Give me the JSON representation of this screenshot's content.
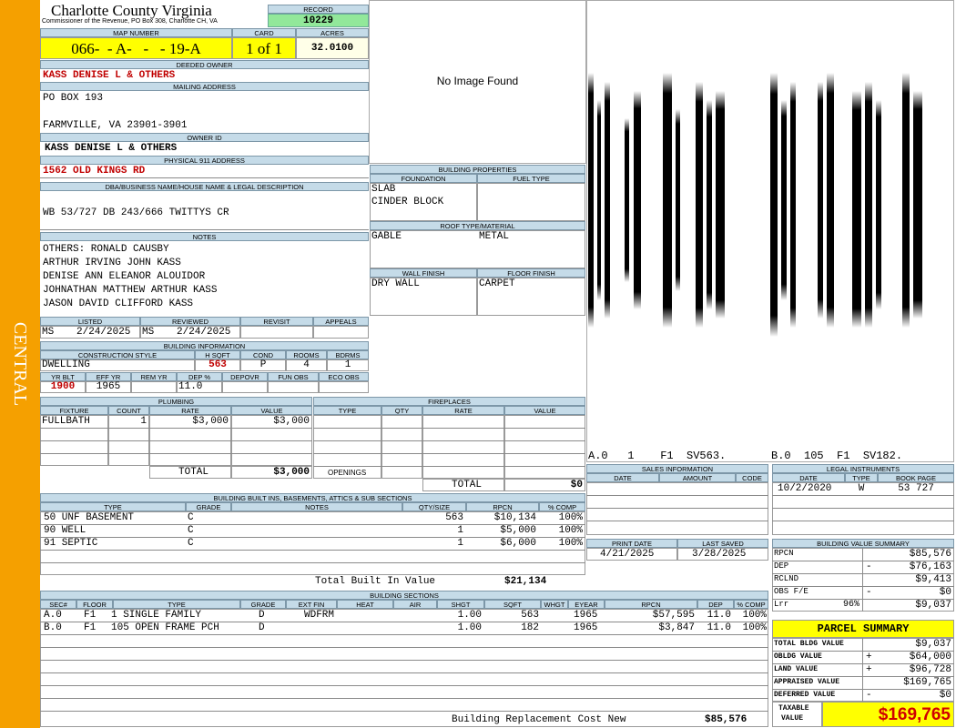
{
  "sidebar": {
    "label": "CENTRAL",
    "color": "#f5a000"
  },
  "header": {
    "county": "Charlotte County Virginia",
    "subtitle": "Commissioner of the Revenue, PO Box 308, Charlotte CH, VA",
    "record_label": "RECORD",
    "record_value": "10229",
    "map_label": "MAP NUMBER",
    "map_value": "066-  - A-   -   - 19-A",
    "card_label": "CARD",
    "card_value": "1 of 1",
    "acres_label": "ACRES",
    "acres_value": "32.0100"
  },
  "owner": {
    "deeded_label": "DEEDED OWNER",
    "deeded_value": "KASS DENISE L & OTHERS",
    "mailing_label": "MAILING ADDRESS",
    "mailing_line1": "PO BOX 193",
    "mailing_line2": "FARMVILLE, VA 23901-3901",
    "owner_id_label": "OWNER ID",
    "owner_id_value": "KASS DENISE L & OTHERS",
    "address_label": "PHYSICAL 911 ADDRESS",
    "address_value": "1562 OLD KINGS RD"
  },
  "legal": {
    "label": "DBA/BUSINESS NAME/HOUSE NAME & LEGAL DESCRIPTION",
    "value": "WB 53/727 DB 243/666 TWITTYS CR"
  },
  "notes": {
    "label": "NOTES",
    "lines": [
      "OTHERS: RONALD CAUSBY",
      "ARTHUR IRVING JOHN KASS",
      "DENISE ANN ELEANOR ALOUIDOR",
      "JOHNATHAN MATTHEW ARTHUR KASS",
      "JASON DAVID CLIFFORD KASS"
    ]
  },
  "listing": {
    "listed_label": "LISTED",
    "reviewed_label": "REVIEWED",
    "revisit_label": "REVISIT",
    "appeals_label": "APPEALS",
    "listed_by": "MS",
    "listed_date": "2/24/2025",
    "reviewed_by": "MS",
    "reviewed_date": "2/24/2025"
  },
  "building_info": {
    "label": "BUILDING INFORMATION",
    "h_construction": "CONSTRUCTION STYLE",
    "h_hsqft": "H SQFT",
    "h_cond": "COND",
    "h_rooms": "ROOMS",
    "h_bdrms": "BDRMS",
    "construction": "DWELLING",
    "hsqft": "563",
    "cond": "P",
    "rooms": "4",
    "bdrms": "1",
    "h_yrblt": "YR BLT",
    "h_effyr": "EFF YR",
    "h_remyr": "REM YR",
    "h_dep": "DEP %",
    "h_depovr": "DEPOVR",
    "h_funobs": "FUN OBS",
    "h_ecoobs": "ECO OBS",
    "yrblt": "1900",
    "effyr": "1965",
    "dep": "11.0"
  },
  "image": {
    "text": "No Image Found"
  },
  "building_props": {
    "label": "BUILDING PROPERTIES",
    "foundation_label": "FOUNDATION",
    "fuel_label": "FUEL TYPE",
    "foundation1": "SLAB",
    "foundation2": "CINDER BLOCK",
    "roof_label": "ROOF TYPE/MATERIAL",
    "roof_type": "GABLE",
    "roof_material": "METAL",
    "wall_label": "WALL FINISH",
    "floor_label": "FLOOR FINISH",
    "wall": "DRY WALL",
    "floor": "CARPET"
  },
  "sketch": {
    "caption1": "A.0   1    F1  SV563.",
    "caption2": "B.0  105  F1  SV182."
  },
  "plumbing": {
    "label": "PLUMBING",
    "h_fixture": "FIXTURE",
    "h_count": "COUNT",
    "h_rate": "RATE",
    "h_value": "VALUE",
    "fixture": "FULLBATH",
    "count": "1",
    "rate": "$3,000",
    "value": "$3,000",
    "total_label": "TOTAL",
    "total": "$3,000"
  },
  "fireplaces": {
    "label": "FIREPLACES",
    "h_type": "TYPE",
    "h_qty": "QTY",
    "h_rate": "RATE",
    "h_value": "VALUE",
    "openings_label": "OPENINGS",
    "total_label": "TOTAL",
    "total": "$0"
  },
  "sales": {
    "label": "SALES INFORMATION",
    "h_date": "DATE",
    "h_amount": "AMOUNT",
    "h_code": "CODE"
  },
  "legal_instruments": {
    "label": "LEGAL INSTRUMENTS",
    "h_date": "DATE",
    "h_type": "TYPE",
    "h_bookpage": "BOOK PAGE",
    "date": "10/2/2020",
    "type": "W",
    "bookpage": "53 727"
  },
  "builtins": {
    "label": "BUILDING BUILT INS, BASEMENTS, ATTICS & SUB SECTIONS",
    "h_type": "TYPE",
    "h_grade": "GRADE",
    "h_notes": "NOTES",
    "h_qty": "QTY/SIZE",
    "h_rpcn": "RPCN",
    "h_comp": "% COMP",
    "rows": [
      {
        "type": "50 UNF BASEMENT",
        "grade": "C",
        "qty": "563",
        "rpcn": "$10,134",
        "comp": "100%"
      },
      {
        "type": "90 WELL",
        "grade": "C",
        "qty": "1",
        "rpcn": "$5,000",
        "comp": "100%"
      },
      {
        "type": "91 SEPTIC",
        "grade": "C",
        "qty": "1",
        "rpcn": "$6,000",
        "comp": "100%"
      }
    ],
    "total_label": "Total Built In Value",
    "total": "$21,134"
  },
  "print": {
    "print_label": "PRINT DATE",
    "saved_label": "LAST SAVED",
    "print_date": "4/21/2025",
    "saved_date": "3/28/2025"
  },
  "value_summary": {
    "label": "BUILDING VALUE SUMMARY",
    "rows": [
      {
        "label": "RPCN",
        "sign": "",
        "value": "$85,576"
      },
      {
        "label": "DEP",
        "sign": "-",
        "value": "$76,163"
      },
      {
        "label": "RCLND",
        "sign": "",
        "value": "$9,413"
      },
      {
        "label": "OBS F/E",
        "sign": "-",
        "value": "$0"
      },
      {
        "label": "Lrr",
        "sign": "96%",
        "value": "$9,037"
      }
    ]
  },
  "sections": {
    "label": "BUILDING SECTIONS",
    "h_sec": "SEC#",
    "h_floor": "FLOOR",
    "h_type": "TYPE",
    "h_grade": "GRADE",
    "h_extfin": "EXT FIN",
    "h_heat": "HEAT",
    "h_air": "AIR",
    "h_shgt": "SHGT",
    "h_sqft": "SQFT",
    "h_whgt": "WHGT",
    "h_eyear": "EYEAR",
    "h_rpcn": "RPCN",
    "h_dep": "DEP",
    "h_comp": "% COMP",
    "rows": [
      {
        "sec": "A.0",
        "floor": "F1",
        "type": "1 SINGLE FAMILY",
        "grade": "D",
        "extfin": "WDFRM",
        "shgt": "1.00",
        "sqft": "563",
        "eyear": "1965",
        "rpcn": "$57,595",
        "dep": "11.0",
        "comp": "100%"
      },
      {
        "sec": "B.0",
        "floor": "F1",
        "type": "105 OPEN FRAME PCH",
        "grade": "D",
        "extfin": "",
        "shgt": "1.00",
        "sqft": "182",
        "eyear": "1965",
        "rpcn": "$3,847",
        "dep": "11.0",
        "comp": "100%"
      }
    ],
    "footer_label": "Building Replacement Cost New",
    "footer_value": "$85,576"
  },
  "parcel": {
    "label": "PARCEL SUMMARY",
    "rows": [
      {
        "label": "TOTAL BLDG VALUE",
        "sign": "",
        "value": "$9,037"
      },
      {
        "label": "OBLDG VALUE",
        "sign": "+",
        "value": "$64,000"
      },
      {
        "label": "LAND VALUE",
        "sign": "+",
        "value": "$96,728"
      },
      {
        "label": "APPRAISED VALUE",
        "sign": "",
        "value": "$169,765"
      },
      {
        "label": "DEFERRED VALUE",
        "sign": "-",
        "value": "$0"
      }
    ],
    "taxable_label1": "TAXABLE",
    "taxable_label2": "VALUE",
    "taxable_value": "$169,765"
  }
}
